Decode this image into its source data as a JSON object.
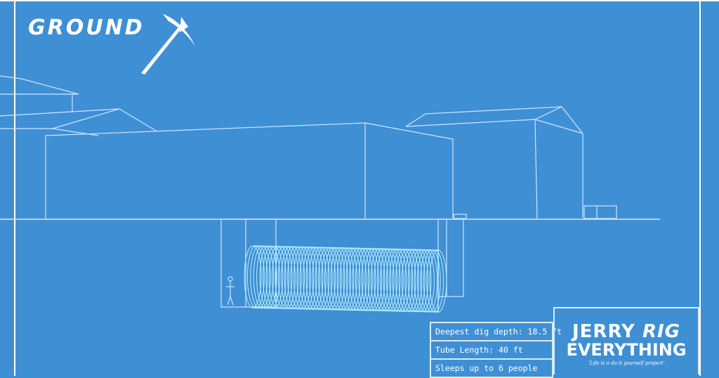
{
  "logo": {
    "text": "GROUND",
    "mark_icon": "pickaxe-x-icon"
  },
  "stats": {
    "depth": "Deepest dig depth: 18.5 ft",
    "tube_length": "Tube Length: 40 ft",
    "sleeps": "Sleeps up to 6 people"
  },
  "brand": {
    "line1_a": "JERRY",
    "line1_b": "RIG",
    "line2": "EVERYTHING",
    "tagline": "'Life is a do it yourself project'"
  },
  "colors": {
    "background": "#3f8fd4",
    "line": "#cfe6ff",
    "tube": "#b8f0ff"
  }
}
